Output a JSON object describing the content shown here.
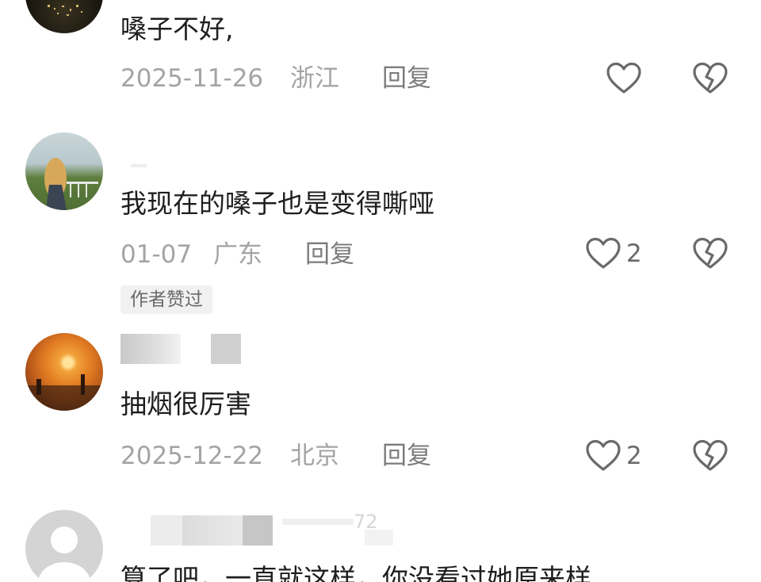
{
  "comments": [
    {
      "text": "嗓子不好,",
      "date": "2025-11-26",
      "location": "浙江",
      "reply_label": "回复",
      "likes": ""
    },
    {
      "text": "我现在的嗓子也是变得嘶哑",
      "date": "01-07",
      "location": "广东",
      "reply_label": "回复",
      "likes": "2",
      "badge": "作者赞过"
    },
    {
      "text": "抽烟很厉害",
      "date": "2025-12-22",
      "location": "北京",
      "reply_label": "回复",
      "likes": "2"
    },
    {
      "text": "算了吧，一直就这样，你没看过她原来样",
      "partial_username_visible": "72"
    }
  ],
  "icons": {
    "like": "heart-outline-icon",
    "dislike": "broken-heart-icon",
    "default_avatar": "person-silhouette-icon"
  },
  "colors": {
    "text": "#1e1e1e",
    "meta": "#a4a4a4",
    "reply": "#7c7c7c",
    "icon": "#6a6a6a",
    "badge_bg": "#f1f1f1"
  }
}
